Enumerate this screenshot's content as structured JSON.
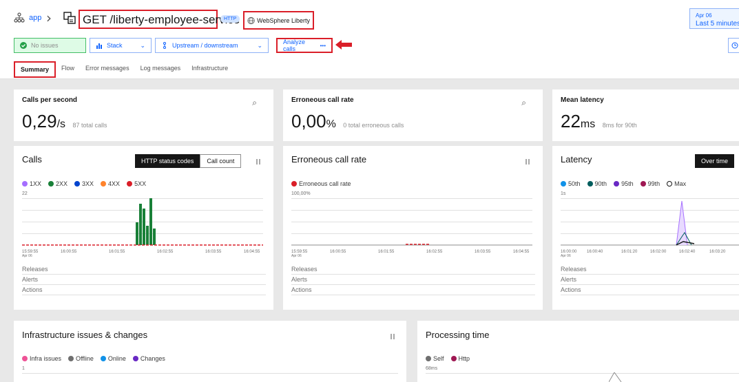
{
  "header": {
    "app_label": "app",
    "service_title": "GET /liberty-employee-service",
    "http_badge": "HTTP",
    "technology": "WebSphere Liberty",
    "date_line1": "Apr 06",
    "date_line2": "Last 5 minutes"
  },
  "toolbar": {
    "no_issues": "No issues",
    "stack": "Stack",
    "upstream": "Upstream / downstream",
    "analyze": "Analyze calls",
    "analyze_icon": "•••"
  },
  "tabs": [
    "Summary",
    "Flow",
    "Error messages",
    "Log messages",
    "Infrastructure"
  ],
  "kpis": {
    "calls": {
      "title": "Calls per second",
      "value": "0,29",
      "unit": "/s",
      "sub": "87 total calls"
    },
    "error": {
      "title": "Erroneous call rate",
      "value": "0,00",
      "unit": "%",
      "sub": "0 total erroneous calls"
    },
    "latency": {
      "title": "Mean latency",
      "value": "22",
      "unit": "ms",
      "sub": "8ms for 90th"
    }
  },
  "calls_chart": {
    "title": "Calls",
    "toggle_on": "HTTP status codes",
    "toggle_off": "Call count",
    "legend": [
      {
        "label": "1XX",
        "color": "#a56eff"
      },
      {
        "label": "2XX",
        "color": "#198038"
      },
      {
        "label": "3XX",
        "color": "#0043ce"
      },
      {
        "label": "4XX",
        "color": "#ff832b"
      },
      {
        "label": "5XX",
        "color": "#da1e28"
      }
    ],
    "ymax_label": "22",
    "xticks": [
      "15:59:55",
      "16:00:55",
      "16:01:55",
      "16:02:55",
      "16:03:55",
      "16:04:55"
    ],
    "xdate": "Apr 06"
  },
  "error_chart": {
    "title": "Erroneous call rate",
    "legend": [
      {
        "label": "Erroneous call rate",
        "color": "#da1e28"
      }
    ],
    "ymax_label": "100,00%",
    "xticks": [
      "15:59:55",
      "16:00:55",
      "16:01:55",
      "16:02:55",
      "16:03:55",
      "16:04:55"
    ],
    "xdate": "Apr 06"
  },
  "latency_chart": {
    "title": "Latency",
    "toggle_on": "Over time",
    "legend": [
      {
        "label": "50th",
        "color": "#1192e8"
      },
      {
        "label": "90th",
        "color": "#005d5d"
      },
      {
        "label": "95th",
        "color": "#6929c4"
      },
      {
        "label": "99th",
        "color": "#9f1853"
      },
      {
        "label": "Max",
        "color": "#ffffff"
      }
    ],
    "ymax_label": "1s",
    "xticks": [
      "16:00:00",
      "16:00:40",
      "16:01:20",
      "16:02:00",
      "16:02:40",
      "16:03:20"
    ],
    "xdate": "Apr 06"
  },
  "rows": [
    "Releases",
    "Alerts",
    "Actions"
  ],
  "infra": {
    "title": "Infrastructure issues & changes",
    "legend": [
      {
        "label": "Infra issues",
        "color": "#ee5396"
      },
      {
        "label": "Offline",
        "color": "#6f6f6f"
      },
      {
        "label": "Online",
        "color": "#1192e8"
      },
      {
        "label": "Changes",
        "color": "#6929c4"
      }
    ],
    "ymax_label": "1"
  },
  "processing": {
    "title": "Processing time",
    "legend": [
      {
        "label": "Self",
        "color": "#6f6f6f"
      },
      {
        "label": "Http",
        "color": "#9f1853"
      }
    ],
    "ymax_label": "68ms"
  }
}
